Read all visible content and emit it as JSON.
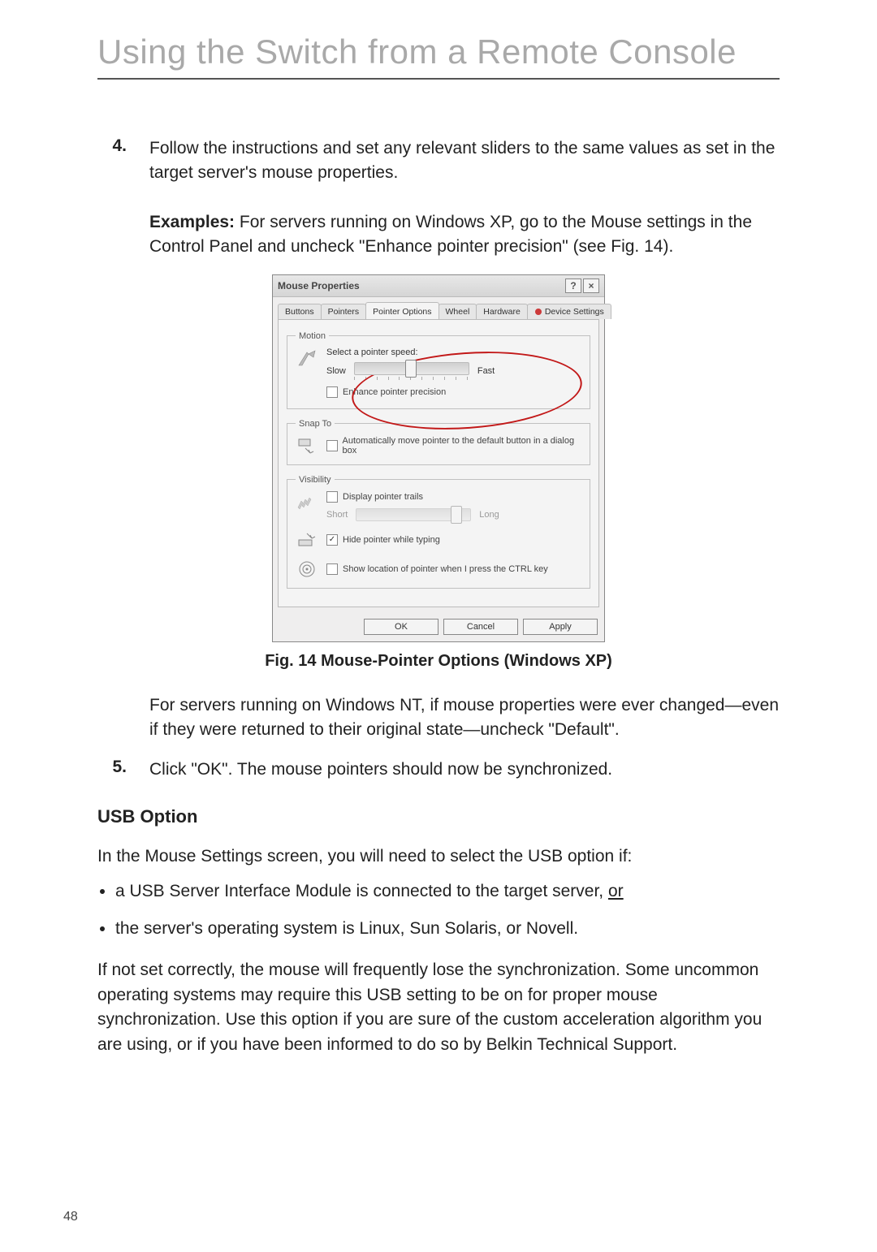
{
  "chapter_title": "Using the Switch from a Remote Console",
  "step4": {
    "num": "4.",
    "text": "Follow the instructions and set any relevant sliders to the same values as set in the target server's mouse properties."
  },
  "examples_label": "Examples:",
  "examples_text": " For servers running on Windows XP, go to the Mouse settings in the Control Panel and uncheck \"Enhance pointer precision\" (see Fig. 14).",
  "dialog": {
    "title": "Mouse Properties",
    "help_btn": "?",
    "close_btn": "×",
    "tabs": {
      "buttons": "Buttons",
      "pointers": "Pointers",
      "pointer_options": "Pointer Options",
      "wheel": "Wheel",
      "hardware": "Hardware",
      "device_settings": "Device Settings"
    },
    "motion": {
      "legend": "Motion",
      "label": "Select a pointer speed:",
      "slow": "Slow",
      "fast": "Fast",
      "enhance": "Enhance pointer precision"
    },
    "snap": {
      "legend": "Snap To",
      "label": "Automatically move pointer to the default button in a dialog box"
    },
    "visibility": {
      "legend": "Visibility",
      "trails": "Display pointer trails",
      "short": "Short",
      "long": "Long",
      "hide": "Hide pointer while typing",
      "ctrl": "Show location of pointer when I press the CTRL key"
    },
    "buttons_footer": {
      "ok": "OK",
      "cancel": "Cancel",
      "apply": "Apply"
    }
  },
  "fig_caption": "Fig. 14 Mouse-Pointer Options (Windows XP)",
  "nt_para": "For servers running on Windows NT, if mouse properties were ever changed—even if they were returned to their original state—uncheck \"Default\".",
  "step5": {
    "num": "5.",
    "text": "Click \"OK\". The mouse pointers should now be synchronized."
  },
  "usb_heading": "USB Option",
  "usb_intro": "In the Mouse Settings screen, you will need to select the USB option if:",
  "usb_bullets": {
    "a_pre": "a USB Server Interface Module is connected to the target server, ",
    "a_or": "or",
    "b": "the server's operating system is Linux, Sun Solaris, or Novell."
  },
  "usb_para": "If not set correctly, the mouse will frequently lose the synchronization. Some uncommon operating systems may require this USB setting to be on for proper mouse synchronization. Use this option if you are sure of the custom acceleration algorithm you are using, or if you have been informed to do so by Belkin Technical Support.",
  "page_number": "48"
}
